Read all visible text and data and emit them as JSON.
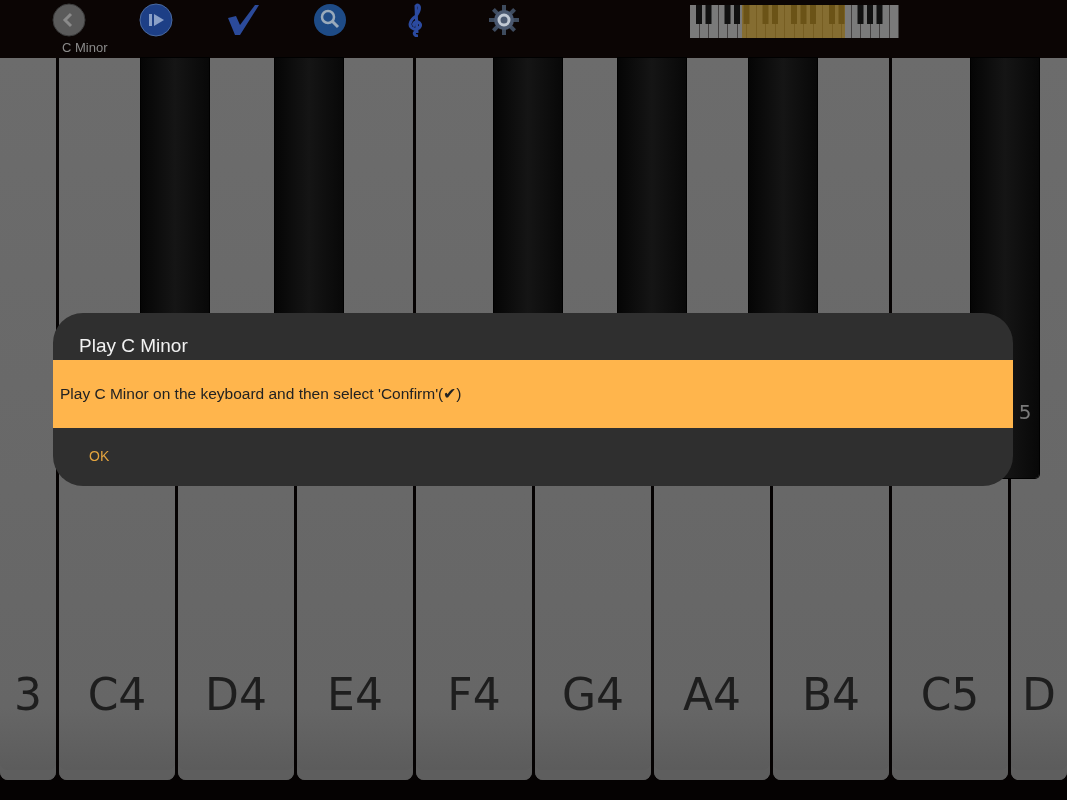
{
  "toolbar": {
    "subtitle": "C Minor",
    "buttons": [
      {
        "kind": "back"
      },
      {
        "kind": "play"
      },
      {
        "kind": "confirm"
      },
      {
        "kind": "search"
      },
      {
        "kind": "clef"
      },
      {
        "kind": "settings"
      }
    ]
  },
  "keyboard": {
    "white_keys": [
      {
        "label": "3",
        "has_black_key": false
      },
      {
        "label": "C4",
        "has_black_key": true
      },
      {
        "label": "D4",
        "has_black_key": true
      },
      {
        "label": "E4",
        "has_black_key": false
      },
      {
        "label": "F4",
        "has_black_key": true
      },
      {
        "label": "G4",
        "has_black_key": true
      },
      {
        "label": "A4",
        "has_black_key": true
      },
      {
        "label": "B4",
        "has_black_key": false
      },
      {
        "label": "C5",
        "has_black_key": true,
        "black_key_label": "5"
      },
      {
        "label": "D",
        "has_black_key": false
      }
    ]
  },
  "dialog": {
    "title": "Play C Minor",
    "message": "Play C Minor on the keyboard and then select 'Confirm'(✔)",
    "buttons": [
      "OK"
    ]
  }
}
